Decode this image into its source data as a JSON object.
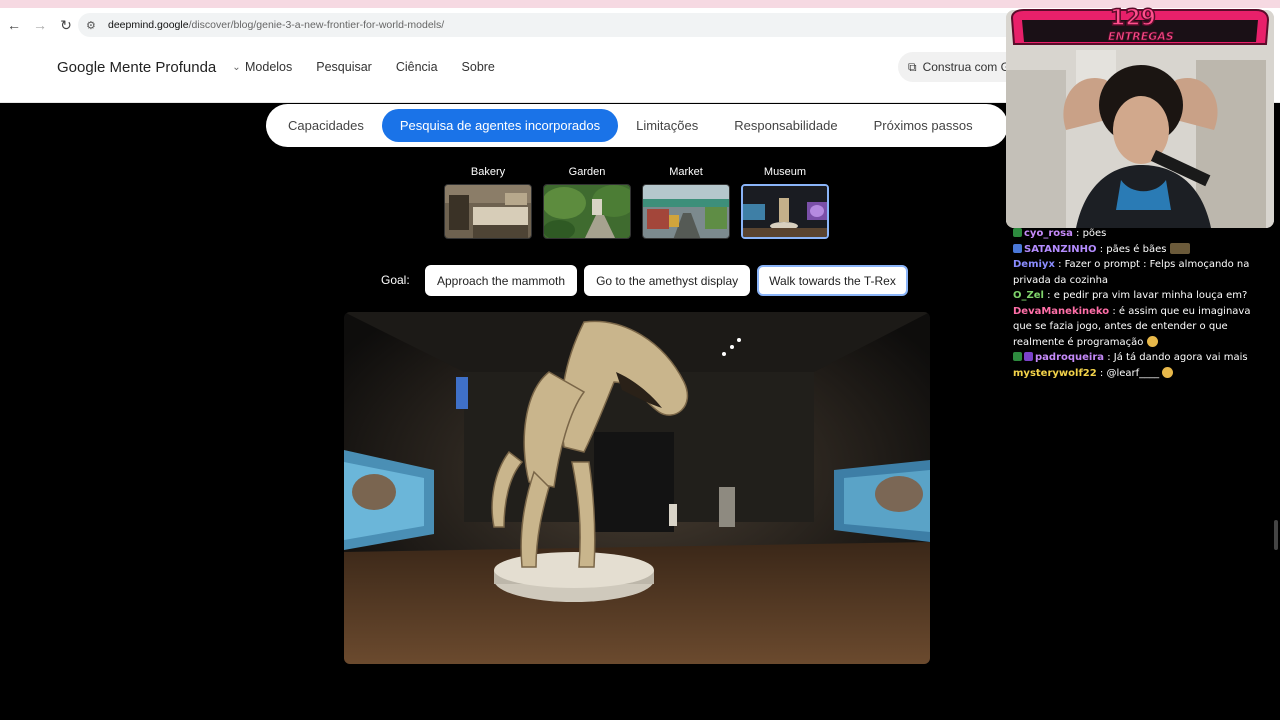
{
  "browser": {
    "url_host": "deepmind.google",
    "url_path": "/discover/blog/genie-3-a-new-frontier-for-world-models/"
  },
  "header": {
    "brand": "Google Mente Profunda",
    "nav": [
      "Modelos",
      "Pesquisar",
      "Ciência",
      "Sobre"
    ],
    "build_label": "Construa com G"
  },
  "section_tabs": [
    {
      "label": "Capacidades",
      "active": false
    },
    {
      "label": "Pesquisa de agentes incorporados",
      "active": true
    },
    {
      "label": "Limitações",
      "active": false
    },
    {
      "label": "Responsabilidade",
      "active": false
    },
    {
      "label": "Próximos passos",
      "active": false
    }
  ],
  "scenes": [
    {
      "label": "Bakery",
      "selected": false
    },
    {
      "label": "Garden",
      "selected": false
    },
    {
      "label": "Market",
      "selected": false
    },
    {
      "label": "Museum",
      "selected": true
    }
  ],
  "goal": {
    "label": "Goal:",
    "options": [
      {
        "label": "Approach the mammoth",
        "selected": false
      },
      {
        "label": "Go to the amethyst display",
        "selected": false
      },
      {
        "label": "Walk towards the T-Rex",
        "selected": true
      }
    ]
  },
  "stream": {
    "badge_number": "129",
    "badge_text": "ENTREGAS"
  },
  "chat": [
    {
      "user": "cyo_rosa",
      "text": "pões",
      "color": "#c58af9"
    },
    {
      "user": "SATANZINHO",
      "text": "pães é bães",
      "color": "#b48cff"
    },
    {
      "user": "Demiyx",
      "text": "Fazer o prompt : Felps almoçando na privada da cozinha",
      "color": "#8a8cff"
    },
    {
      "user": "O_Zel",
      "text": "e pedir pra vim lavar minha louça em?",
      "color": "#7fd36b"
    },
    {
      "user": "DevaManekineko",
      "text": "é assim que eu imaginava que se fazia jogo, antes de entender o que realmente é programação",
      "color": "#ff6fa8"
    },
    {
      "user": "padroqueira",
      "text": "Já tá dando agora vai mais",
      "color": "#c58af9"
    },
    {
      "user": "mysterywolf22",
      "text": "@learf____",
      "color": "#f3d34a"
    }
  ]
}
